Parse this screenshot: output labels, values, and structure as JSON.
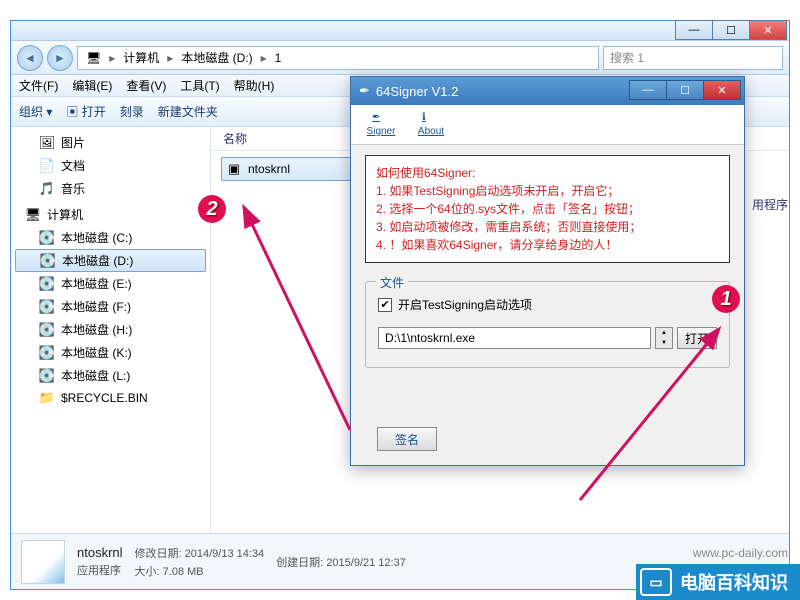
{
  "explorer": {
    "breadcrumb": {
      "computer": "计算机",
      "drive": "本地磁盘 (D:)",
      "folder": "1"
    },
    "search_placeholder": "搜索 1",
    "menu": {
      "file": "文件(F)",
      "edit": "编辑(E)",
      "view": "查看(V)",
      "tools": "工具(T)",
      "help": "帮助(H)"
    },
    "toolbar": {
      "organize": "组织 ▾",
      "open": "打开",
      "burn": "刻录",
      "newfolder": "新建文件夹"
    },
    "sidebar": {
      "pictures": "图片",
      "documents": "文档",
      "music": "音乐",
      "computer": "计算机",
      "drives": [
        "本地磁盘 (C:)",
        "本地磁盘 (D:)",
        "本地磁盘 (E:)",
        "本地磁盘 (F:)",
        "本地磁盘 (H:)",
        "本地磁盘 (K:)",
        "本地磁盘 (L:)",
        "$RECYCLE.BIN"
      ]
    },
    "column_name": "名称",
    "file": {
      "name": "ntoskrnl"
    },
    "truncated_right": "用程序",
    "status": {
      "name": "ntoskrnl",
      "type": "应用程序",
      "mod_label": "修改日期:",
      "mod_val": "2014/9/13 14:34",
      "size_label": "大小:",
      "size_val": "7.08 MB",
      "create_label": "创建日期:",
      "create_val": "2015/9/21 12:37"
    }
  },
  "signer": {
    "title": "64Signer V1.2",
    "tab_signer": "Signer",
    "tab_about": "About",
    "help_title": "如何使用64Signer:",
    "help_lines": [
      "1. 如果TestSigning启动选项未开启，开启它；",
      "2. 选择一个64位的.sys文件，点击「签名」按钮；",
      "3. 如启动项被修改，需重启系统；否则直接使用；",
      "4. ！如果喜欢64Signer，请分享给身边的人！"
    ],
    "group_label": "文件",
    "checkbox_label": "开启TestSigning启动选项",
    "path_value": "D:\\1\\ntoskrnl.exe",
    "open_btn": "打开",
    "sign_btn": "签名"
  },
  "annotations": {
    "n1": "1",
    "n2": "2"
  },
  "watermark": {
    "text": "电脑百科知识",
    "url": "www.pc-daily.com"
  }
}
